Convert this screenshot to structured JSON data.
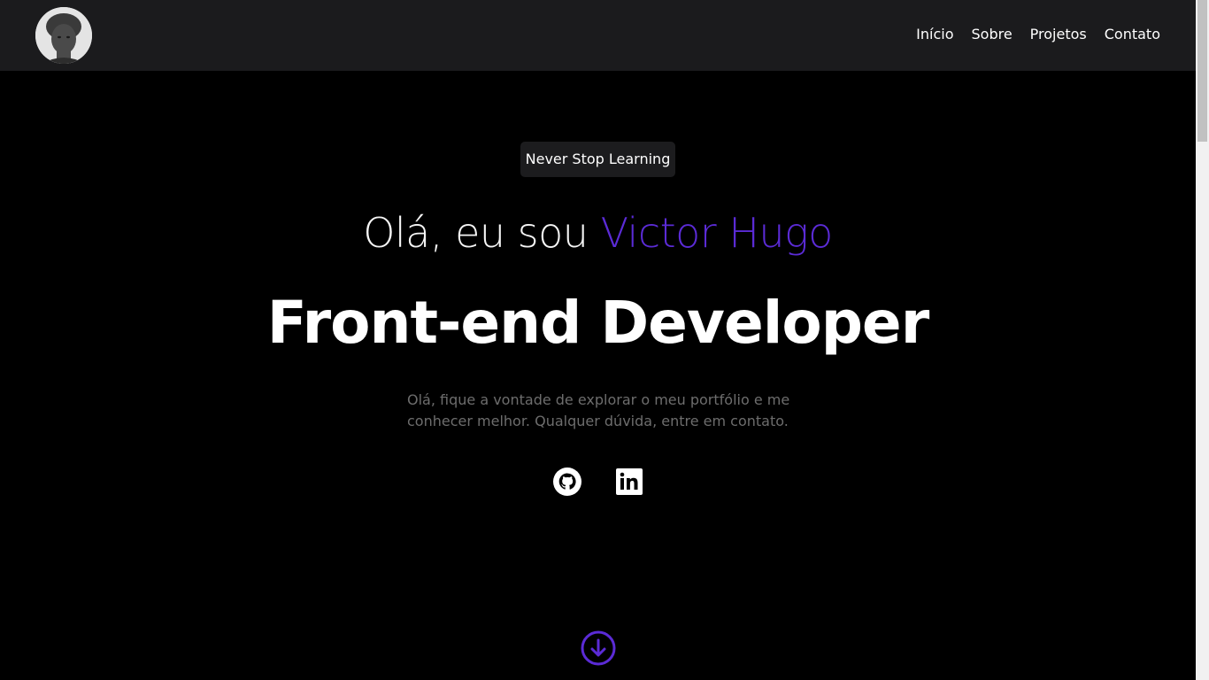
{
  "header": {
    "nav": [
      {
        "label": "Início"
      },
      {
        "label": "Sobre"
      },
      {
        "label": "Projetos"
      },
      {
        "label": "Contato"
      }
    ]
  },
  "hero": {
    "badge": "Never Stop Learning",
    "greeting_prefix": "Olá, eu sou ",
    "greeting_name": "Victor Hugo",
    "role": "Front-end Developer",
    "description": "Olá, fique a vontade de explorar o meu portfólio e me conhecer melhor. Qualquer dúvida, entre em contato."
  },
  "social": [
    {
      "icon": "github-icon"
    },
    {
      "icon": "linkedin-icon"
    }
  ],
  "scroll_icon": "arrow-down-circle-icon",
  "colors": {
    "background": "#000000",
    "header_bg": "#1b1b1d",
    "accent": "#5b2bd6",
    "description_text": "#6d6d6d"
  }
}
